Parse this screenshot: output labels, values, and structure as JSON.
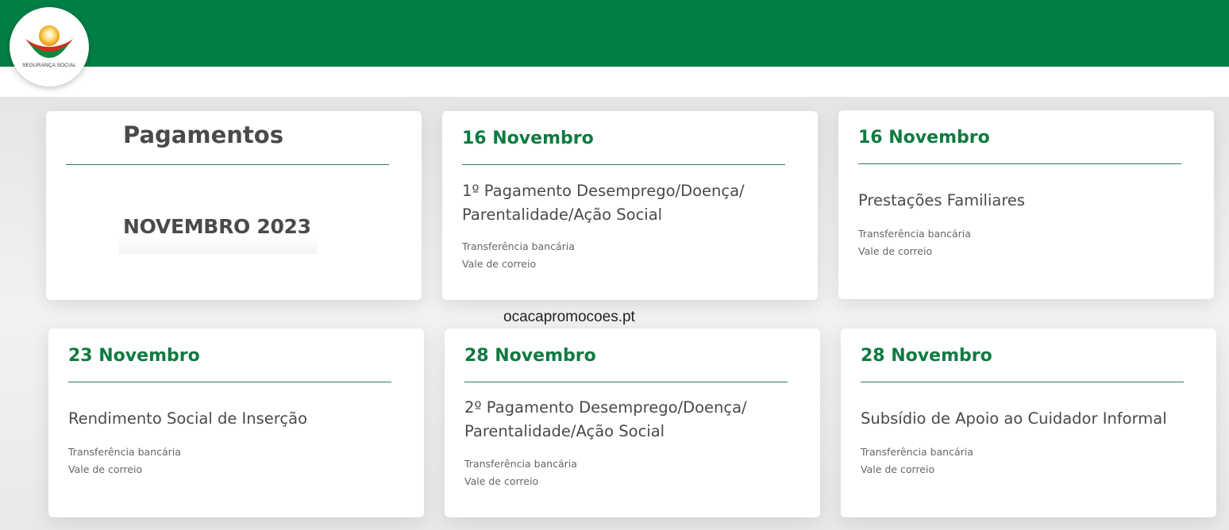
{
  "header": {
    "logo_text": "SEGURANÇA SOCIAL",
    "brand_color": "#007f45",
    "logo_icon": "seguranca-social-sun-logo"
  },
  "intro_card": {
    "heading": "Pagamentos",
    "month": "NOVEMBRO 2023"
  },
  "payments": [
    {
      "date": "16 Novembro",
      "title_lines": [
        "1º Pagamento Desemprego/Doença/",
        "Parentalidade/Ação Social"
      ],
      "methods": [
        "Transferência bancária",
        "Vale de correio"
      ]
    },
    {
      "date": "16 Novembro",
      "title_lines": [
        "Prestações Familiares"
      ],
      "methods": [
        "Transferência bancária",
        "Vale de correio"
      ]
    },
    {
      "date": "23 Novembro",
      "title_lines": [
        "Rendimento Social de Inserção"
      ],
      "methods": [
        "Transferência bancária",
        "Vale de correio"
      ]
    },
    {
      "date": "28 Novembro",
      "title_lines": [
        "2º Pagamento Desemprego/Doença/",
        "Parentalidade/Ação Social"
      ],
      "methods": [
        "Transferência bancária",
        "Vale de correio"
      ]
    },
    {
      "date": "28 Novembro",
      "title_lines": [
        "Subsídio de Apoio ao Cuidador Informal"
      ],
      "methods": [
        "Transferência bancária",
        "Vale de correio"
      ]
    }
  ],
  "watermark": "ocacapromocoes.pt",
  "colors": {
    "date_green": "#0f7a40",
    "text_dark": "#4a4a4a",
    "text_muted": "#666666"
  }
}
